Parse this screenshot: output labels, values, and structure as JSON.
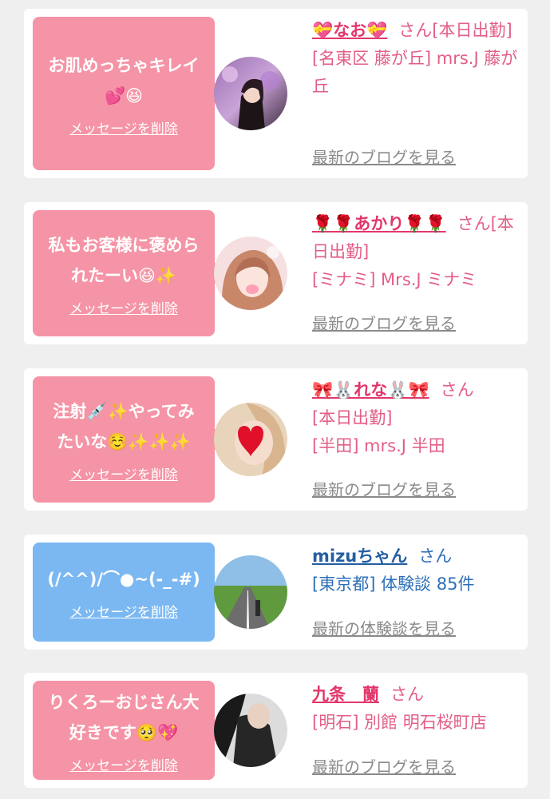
{
  "colors": {
    "card_background": "#ffffff",
    "page_background": "#efefef",
    "pink_bubble": "#f594a6",
    "blue_bubble": "#7bb8f2",
    "pink_text": "#e35e86",
    "blue_text": "#2d6fb8",
    "link_gray": "#8a8a8a"
  },
  "cards": [
    {
      "message": "お肌めっちゃキレイ💕😆",
      "delete_label": "メッセージを削除",
      "name": "💝なお💝",
      "suffix": "さん",
      "status": "[本日出勤]",
      "location": "[名東区 藤が丘] mrs.J 藤が丘",
      "link": "最新のブログを見る",
      "avatar_icon": "woman-photo-avatar"
    },
    {
      "message": "私もお客様に褒められたーい😆✨",
      "delete_label": "メッセージを削除",
      "name": "🌹🌹あかり🌹🌹",
      "suffix": "さん",
      "status": "[本日出勤]",
      "location": "[ミナミ] Mrs.J ミナミ",
      "link": "最新のブログを見る",
      "avatar_icon": "woman-photo-avatar"
    },
    {
      "message": "注射💉✨やってみたいな☺️✨✨✨",
      "delete_label": "メッセージを削除",
      "name": "🎀🐰れな🐰🎀",
      "suffix": "さん",
      "status": "[本日出勤]",
      "location": "[半田] mrs.J 半田",
      "link": "最新のブログを見る",
      "avatar_icon": "heart-covered-face-avatar"
    },
    {
      "message": "(/^^)/⌒●~(-_-#)",
      "delete_label": "メッセージを削除",
      "name": "mizuちゃん",
      "suffix": "さん",
      "status": "",
      "location": "[東京都] 体験談 85件",
      "link": "最新の体験談を見る",
      "avatar_icon": "road-landscape-avatar"
    },
    {
      "message": "りくろーおじさん大好きです🥺💖",
      "delete_label": "メッセージを削除",
      "name": "九条　蘭",
      "suffix": "さん",
      "status": "",
      "location": "[明石] 別館 明石桜町店",
      "link": "最新のブログを見る",
      "avatar_icon": "woman-photo-avatar"
    }
  ]
}
